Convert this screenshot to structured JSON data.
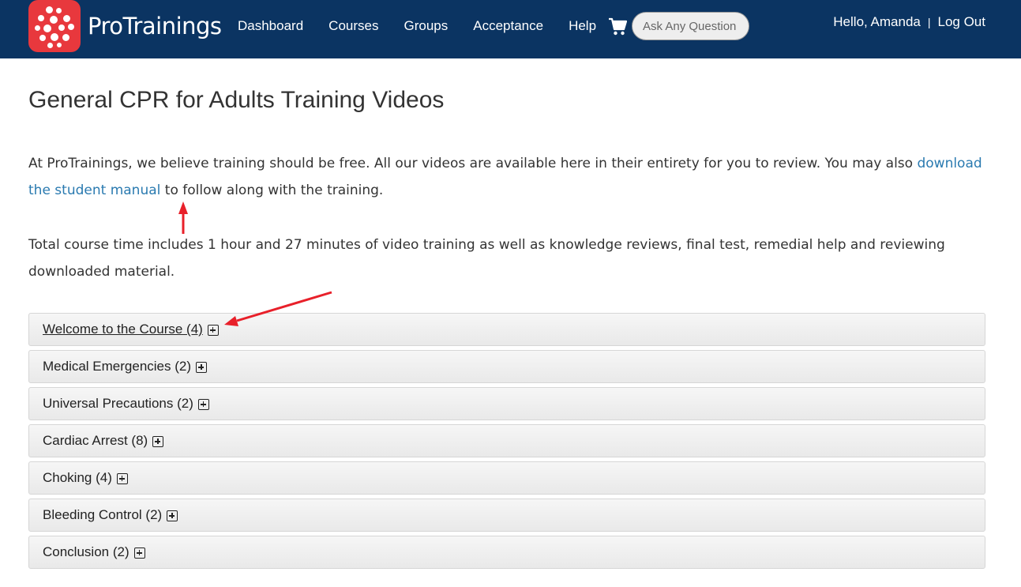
{
  "brand": {
    "name": "ProTrainings",
    "logo_color": "#e8383d",
    "navbar_color": "#0b3462"
  },
  "nav": {
    "items": [
      {
        "label": "Dashboard"
      },
      {
        "label": "Courses"
      },
      {
        "label": "Groups"
      },
      {
        "label": "Acceptance"
      },
      {
        "label": "Help"
      }
    ],
    "cart_icon": "shopping-cart-icon",
    "search_placeholder": "Ask Any Question"
  },
  "user": {
    "greeting": "Hello, Amanda",
    "separator": "|",
    "logout_label": "Log Out"
  },
  "page": {
    "title": "General CPR for Adults Training Videos",
    "intro_before": "At ProTrainings, we believe training should be free. All our videos are available here in their entirety for you to review. You may also ",
    "intro_link": "download the student manual",
    "intro_after": " to follow along with the training.",
    "time_text": "Total course time includes 1 hour and 27 minutes of video training as well as knowledge reviews, final test, remedial help and reviewing downloaded material.",
    "link_color": "#2a7ab0",
    "annotation_color": "#e8202a"
  },
  "sections": [
    {
      "label": "Welcome to the Course (4)"
    },
    {
      "label": "Medical Emergencies (2)"
    },
    {
      "label": "Universal Precautions (2)"
    },
    {
      "label": "Cardiac Arrest (8)"
    },
    {
      "label": "Choking (4)"
    },
    {
      "label": "Bleeding Control (2)"
    },
    {
      "label": "Conclusion (2)"
    }
  ]
}
